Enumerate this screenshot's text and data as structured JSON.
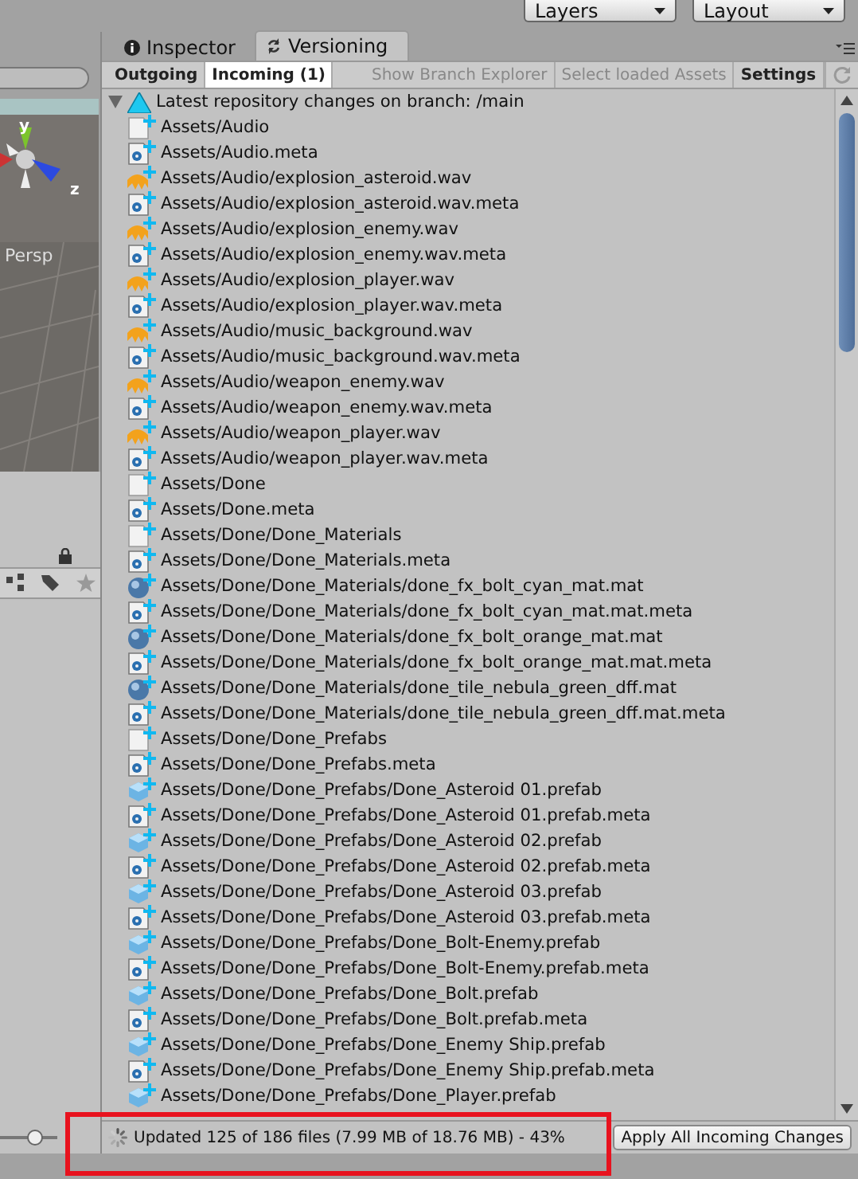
{
  "top_bar": {
    "dropdowns": [
      "Layers",
      "Layout"
    ]
  },
  "scene_view": {
    "axis_labels": [
      "y",
      "z"
    ],
    "projection": "Persp"
  },
  "zoom_slider": {
    "level": 0.62
  },
  "tabs": [
    {
      "label": "Inspector",
      "selected": false
    },
    {
      "label": "Versioning",
      "selected": true
    }
  ],
  "toolbar": [
    {
      "label": "Outgoing",
      "selected": false,
      "disabled": false
    },
    {
      "label": "Incoming (1)",
      "selected": true,
      "disabled": false
    },
    {
      "label": "Show Branch Explorer",
      "selected": false,
      "disabled": true
    },
    {
      "label": "Select loaded Assets",
      "selected": false,
      "disabled": true
    },
    {
      "label": "Settings",
      "selected": false,
      "disabled": false
    }
  ],
  "tree": {
    "header": "Latest repository changes on branch: /main",
    "expanded": true,
    "rows": [
      {
        "name": "Assets/Audio",
        "kind": "folder"
      },
      {
        "name": "Assets/Audio.meta",
        "kind": "meta"
      },
      {
        "name": "Assets/Audio/explosion_asteroid.wav",
        "kind": "audio"
      },
      {
        "name": "Assets/Audio/explosion_asteroid.wav.meta",
        "kind": "meta"
      },
      {
        "name": "Assets/Audio/explosion_enemy.wav",
        "kind": "audio"
      },
      {
        "name": "Assets/Audio/explosion_enemy.wav.meta",
        "kind": "meta"
      },
      {
        "name": "Assets/Audio/explosion_player.wav",
        "kind": "audio"
      },
      {
        "name": "Assets/Audio/explosion_player.wav.meta",
        "kind": "meta"
      },
      {
        "name": "Assets/Audio/music_background.wav",
        "kind": "audio"
      },
      {
        "name": "Assets/Audio/music_background.wav.meta",
        "kind": "meta"
      },
      {
        "name": "Assets/Audio/weapon_enemy.wav",
        "kind": "audio"
      },
      {
        "name": "Assets/Audio/weapon_enemy.wav.meta",
        "kind": "meta"
      },
      {
        "name": "Assets/Audio/weapon_player.wav",
        "kind": "audio"
      },
      {
        "name": "Assets/Audio/weapon_player.wav.meta",
        "kind": "meta"
      },
      {
        "name": "Assets/Done",
        "kind": "folder"
      },
      {
        "name": "Assets/Done.meta",
        "kind": "meta"
      },
      {
        "name": "Assets/Done/Done_Materials",
        "kind": "folder"
      },
      {
        "name": "Assets/Done/Done_Materials.meta",
        "kind": "meta"
      },
      {
        "name": "Assets/Done/Done_Materials/done_fx_bolt_cyan_mat.mat",
        "kind": "material"
      },
      {
        "name": "Assets/Done/Done_Materials/done_fx_bolt_cyan_mat.mat.meta",
        "kind": "meta"
      },
      {
        "name": "Assets/Done/Done_Materials/done_fx_bolt_orange_mat.mat",
        "kind": "material"
      },
      {
        "name": "Assets/Done/Done_Materials/done_fx_bolt_orange_mat.mat.meta",
        "kind": "meta"
      },
      {
        "name": "Assets/Done/Done_Materials/done_tile_nebula_green_dff.mat",
        "kind": "material"
      },
      {
        "name": "Assets/Done/Done_Materials/done_tile_nebula_green_dff.mat.meta",
        "kind": "meta"
      },
      {
        "name": "Assets/Done/Done_Prefabs",
        "kind": "folder"
      },
      {
        "name": "Assets/Done/Done_Prefabs.meta",
        "kind": "meta"
      },
      {
        "name": "Assets/Done/Done_Prefabs/Done_Asteroid 01.prefab",
        "kind": "prefab"
      },
      {
        "name": "Assets/Done/Done_Prefabs/Done_Asteroid 01.prefab.meta",
        "kind": "meta"
      },
      {
        "name": "Assets/Done/Done_Prefabs/Done_Asteroid 02.prefab",
        "kind": "prefab"
      },
      {
        "name": "Assets/Done/Done_Prefabs/Done_Asteroid 02.prefab.meta",
        "kind": "meta"
      },
      {
        "name": "Assets/Done/Done_Prefabs/Done_Asteroid 03.prefab",
        "kind": "prefab"
      },
      {
        "name": "Assets/Done/Done_Prefabs/Done_Asteroid 03.prefab.meta",
        "kind": "meta"
      },
      {
        "name": "Assets/Done/Done_Prefabs/Done_Bolt-Enemy.prefab",
        "kind": "prefab"
      },
      {
        "name": "Assets/Done/Done_Prefabs/Done_Bolt-Enemy.prefab.meta",
        "kind": "meta"
      },
      {
        "name": "Assets/Done/Done_Prefabs/Done_Bolt.prefab",
        "kind": "prefab"
      },
      {
        "name": "Assets/Done/Done_Prefabs/Done_Bolt.prefab.meta",
        "kind": "meta"
      },
      {
        "name": "Assets/Done/Done_Prefabs/Done_Enemy Ship.prefab",
        "kind": "prefab"
      },
      {
        "name": "Assets/Done/Done_Prefabs/Done_Enemy Ship.prefab.meta",
        "kind": "meta"
      },
      {
        "name": "Assets/Done/Done_Prefabs/Done_Player.prefab",
        "kind": "prefab"
      }
    ]
  },
  "status_bar": {
    "message": "Updated 125 of 186 files (7.99 MB of 18.76 MB) - 43%",
    "button": "Apply All Incoming Changes"
  }
}
